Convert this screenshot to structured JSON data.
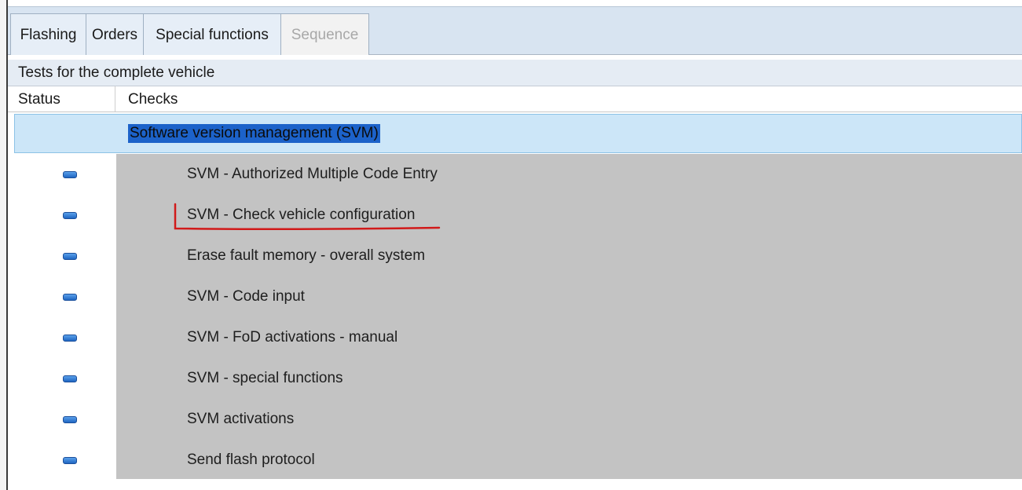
{
  "tabs": [
    {
      "label": "Flashing",
      "enabled": true
    },
    {
      "label": "Orders",
      "enabled": true
    },
    {
      "label": "Special functions",
      "enabled": true,
      "active": true
    },
    {
      "label": "Sequence",
      "enabled": false
    }
  ],
  "section_title": "Tests for the complete vehicle",
  "columns": {
    "status": "Status",
    "checks": "Checks"
  },
  "group": {
    "label": "Software version management  (SVM)",
    "selected": true
  },
  "items": [
    {
      "label": "SVM - Authorized Multiple Code Entry",
      "status_icon": "status-pending-icon"
    },
    {
      "label": "SVM - Check vehicle configuration",
      "status_icon": "status-pending-icon",
      "annotated": true
    },
    {
      "label": "Erase fault memory - overall system",
      "status_icon": "status-pending-icon"
    },
    {
      "label": "SVM - Code input",
      "status_icon": "status-pending-icon"
    },
    {
      "label": "SVM - FoD activations - manual",
      "status_icon": "status-pending-icon"
    },
    {
      "label": "SVM - special functions",
      "status_icon": "status-pending-icon"
    },
    {
      "label": "SVM activations",
      "status_icon": "status-pending-icon"
    },
    {
      "label": "Send flash protocol",
      "status_icon": "status-pending-icon"
    }
  ],
  "colors": {
    "tabbar": "#d8e4f1",
    "selection": "#1c62c9",
    "group_row": "#cce6f8",
    "items_bg": "#c3c3c3",
    "annotation": "#d11a1a"
  }
}
